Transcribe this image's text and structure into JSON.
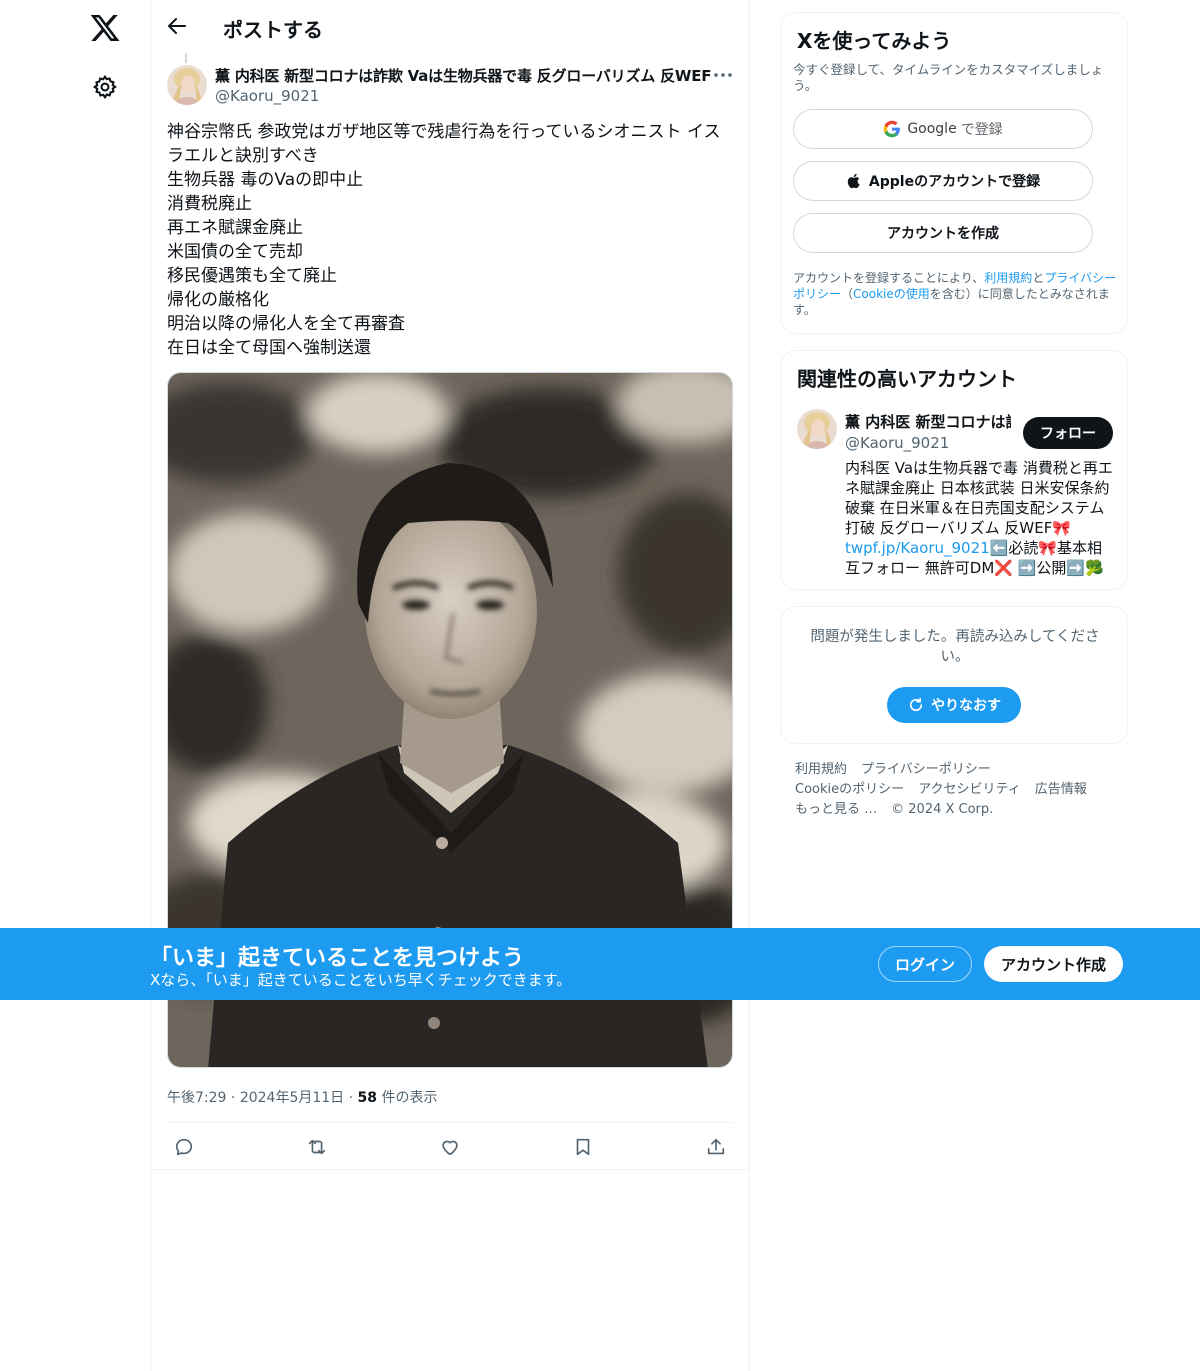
{
  "header": {
    "title": "ポストする"
  },
  "post": {
    "author_name": "薫 内科医 新型コロナは詐欺 Vaは生物兵器で毒 反グローバリズム 反WEF",
    "author_handle": "@Kaoru_9021",
    "text_lines": [
      "神谷宗幣氏 参政党はガザ地区等で残虐行為を行っているシオニスト イス",
      "ラエルと訣別すべき",
      "生物兵器 毒のVaの即中止",
      "消費税廃止",
      "再エネ賦課金廃止",
      "米国債の全て売却",
      "移民優遇策も全て廃止",
      "帰化の厳格化",
      "明治以降の帰化人を全て再審査",
      "在日は全て母国へ強制送還"
    ],
    "time": "午後7:29",
    "date": "2024年5月11日",
    "views_count": "58",
    "views_label": "件の表示"
  },
  "signup": {
    "title": "Xを使ってみよう",
    "description": "今すぐ登録して、タイムラインをカスタマイズしましょう。",
    "google_brand": "Google",
    "google_suffix": "で登録",
    "apple_label": "Appleのアカウントで登録",
    "create_label": "アカウントを作成",
    "terms_prefix": "アカウントを登録することにより、",
    "terms_link": "利用規約",
    "terms_and": "と",
    "privacy_link": "プライバシーポリシー",
    "terms_mid": "（",
    "cookie_link": "Cookieの使用",
    "terms_suffix": "を含む）に同意したとみなされます。"
  },
  "related": {
    "title": "関連性の高いアカウント",
    "name": "薫 内科医 新型コロナは詐欺 Vaは生物兵器で毒",
    "handle": "@Kaoru_9021",
    "follow_label": "フォロー",
    "bio_lines": [
      "内科医 Vaは生物兵器で毒 消費税と再エ",
      "ネ賦課金廃止 日本核武装 日米安保条約",
      "破棄 在日米軍＆在日売国支配システム",
      "打破 反グローバリズム 反WEF🎀"
    ],
    "bio_link": "twpf.jp/Kaoru_9021",
    "bio_after_link": "⬅️必読🎀基本相",
    "bio_last": "互フォロー 無許可DM❌ ➡️公開➡️🥦"
  },
  "error": {
    "message": "問題が発生しました。再読み込みしてください。",
    "retry_label": "やりなおす"
  },
  "footer": {
    "links": [
      "利用規約",
      "プライバシーポリシー",
      "Cookieのポリシー",
      "アクセシビリティ",
      "広告情報",
      "もっと見る …"
    ],
    "copyright": "© 2024 X Corp."
  },
  "banner": {
    "title": "「いま」起きていることを見つけよう",
    "subtitle": "Xなら、「いま」起きていることをいち早くチェックできます。",
    "login_label": "ログイン",
    "signup_label": "アカウント作成"
  },
  "colors": {
    "accent": "#1d9bf0",
    "text": "#0f1419",
    "secondary": "#536471",
    "border": "#eff3f4"
  },
  "icons": [
    "x-logo-icon",
    "gear-icon",
    "back-arrow-icon",
    "more-icon",
    "reply-icon",
    "repost-icon",
    "like-icon",
    "bookmark-icon",
    "share-icon",
    "google-icon",
    "apple-icon",
    "refresh-icon"
  ]
}
